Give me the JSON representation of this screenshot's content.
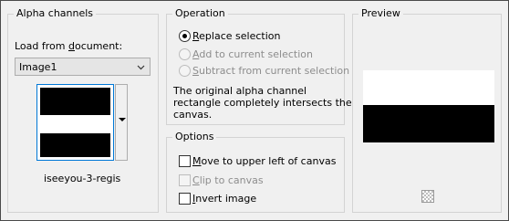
{
  "alpha_channels": {
    "title": "Alpha channels",
    "load_from_label_prefix": "Load from ",
    "load_from_label_accel": "d",
    "load_from_label_suffix": "ocument:",
    "document_select": {
      "value": "Image1"
    },
    "channel_name": "iseeyou-3-regis"
  },
  "operation": {
    "title": "Operation",
    "options": [
      {
        "accel": "R",
        "rest": "eplace selection",
        "selected": true,
        "disabled": false
      },
      {
        "accel": "A",
        "rest": "dd to current selection",
        "selected": false,
        "disabled": true
      },
      {
        "accel": "S",
        "rest": "ubtract from current selection",
        "selected": false,
        "disabled": true
      }
    ],
    "message_line1": "The original alpha channel",
    "message_line2": "rectangle completely intersects the",
    "message_line3": "canvas."
  },
  "options": {
    "title": "Options",
    "items": [
      {
        "accel": "M",
        "rest": "ove to upper left of canvas",
        "checked": false,
        "disabled": false
      },
      {
        "accel": "C",
        "rest": "lip to canvas",
        "checked": false,
        "disabled": true
      },
      {
        "accel": "I",
        "rest": "nvert image",
        "checked": false,
        "disabled": false
      }
    ]
  },
  "preview": {
    "title": "Preview",
    "background_icon": "transparency-checker-icon"
  }
}
